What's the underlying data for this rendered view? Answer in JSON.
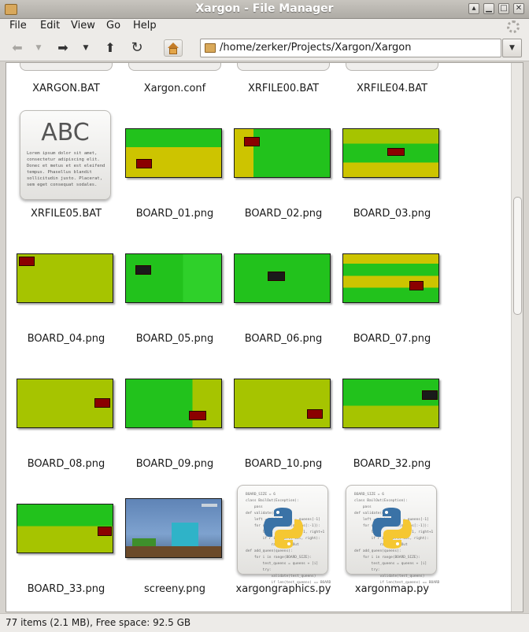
{
  "window": {
    "title": "Xargon - File Manager"
  },
  "menu": {
    "file": "File",
    "edit": "Edit",
    "view": "View",
    "go": "Go",
    "help": "Help"
  },
  "toolbar": {
    "back_icon": "back-arrow-icon",
    "forward_icon": "forward-arrow-icon",
    "up_icon": "up-arrow-icon",
    "reload_icon": "reload-icon",
    "home_icon": "home-icon"
  },
  "location": {
    "path": "/home/zerker/Projects/Xargon/Xargon"
  },
  "files": {
    "row0": [
      "XARGON.BAT",
      "Xargon.conf",
      "XRFILE00.BAT",
      "XRFILE04.BAT"
    ],
    "row1": [
      "XRFILE05.BAT",
      "BOARD_01.png",
      "BOARD_02.png",
      "BOARD_03.png"
    ],
    "row2": [
      "BOARD_04.png",
      "BOARD_05.png",
      "BOARD_06.png",
      "BOARD_07.png"
    ],
    "row3": [
      "BOARD_08.png",
      "BOARD_09.png",
      "BOARD_10.png",
      "BOARD_32.png"
    ],
    "row4": [
      "BOARD_33.png",
      "screeny.png",
      "xargongraphics.py",
      "xargonmap.py"
    ]
  },
  "preview": {
    "abc": "ABC",
    "lorem": "Lorem ipsum dolor sit amet, consectetur adipiscing elit. Donec et metus et est eleifend tempus. Phasellus blandit sollicitudin justo. Placerat, sem eget consequat sodales.",
    "code": "BOARD_SIZE = 6\nclass BailOut(Exception):\n    pass\ndef validate(queens):\n    left = right = col = queens[-1]\n    for r in reversed(queens[:-1]):\n        left, right = left-1, right+1\n        if r in (left, col, right):\n            raise BailOut\ndef add_queen(queens):\n    for i in range(BOARD_SIZE):\n        test_queens = queens + [i]\n        try:\n            validate(test_queens)\n            if len(test_queens) == BOARD"
  },
  "status": {
    "text": "77 items (2.1 MB), Free space: 92.5 GB"
  },
  "colors": {
    "board_green": "#22c21c",
    "board_olive": "#a6c400",
    "board_yellow": "#cdc400",
    "block_red": "#8b0000"
  }
}
